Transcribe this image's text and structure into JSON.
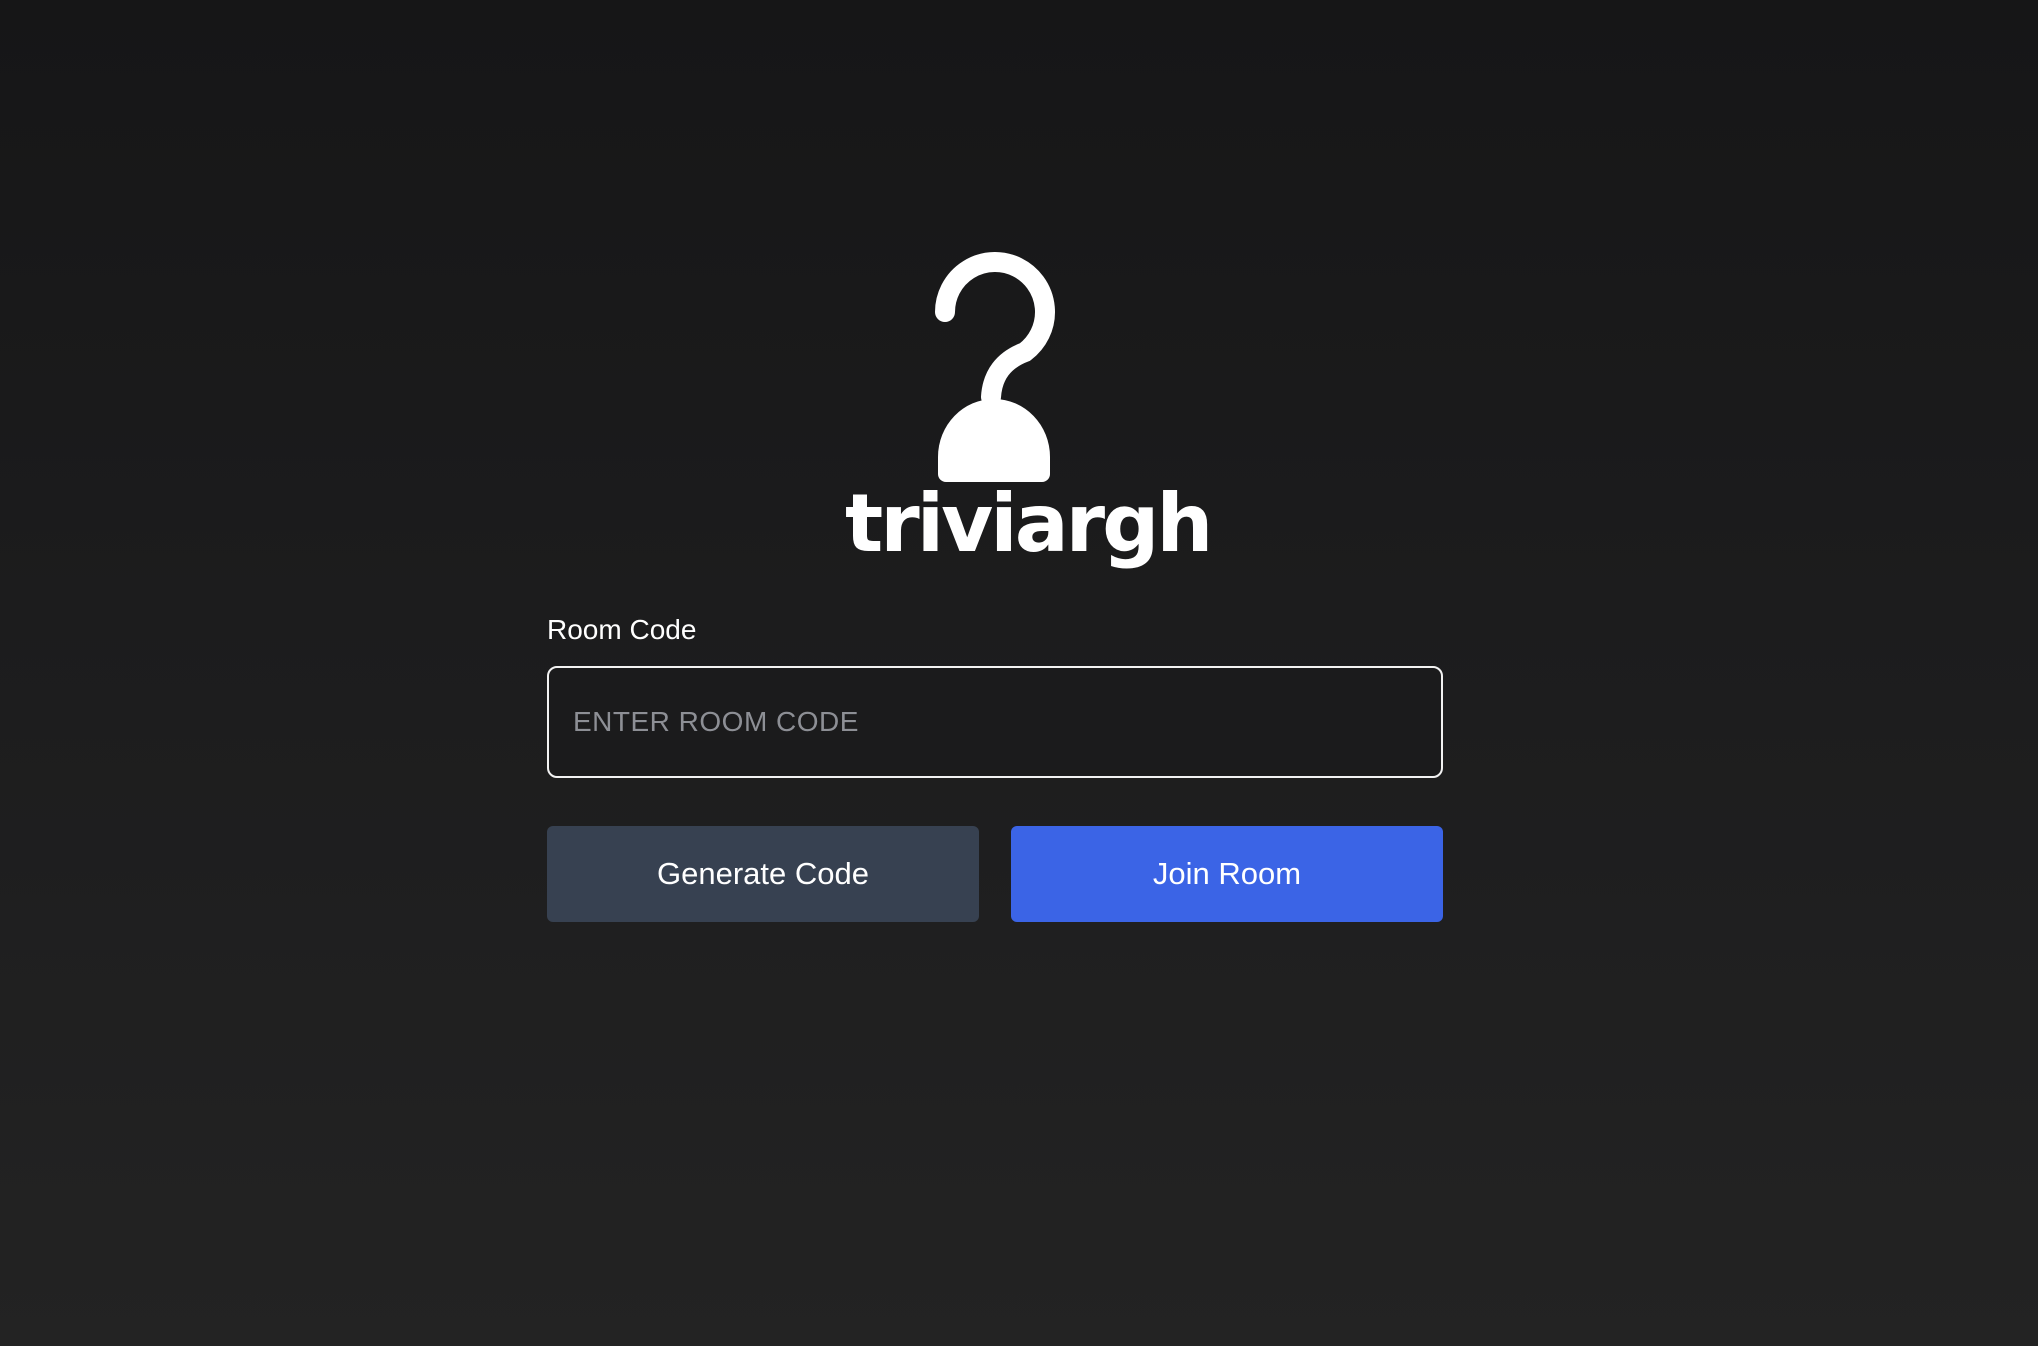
{
  "app": {
    "logo_icon": "hook-question-icon",
    "name": "triviargh"
  },
  "form": {
    "label": "Room Code",
    "input_value": "",
    "input_placeholder": "ENTER ROOM CODE",
    "generate_label": "Generate Code",
    "join_label": "Join Room"
  },
  "colors": {
    "background": "#1c1c1d",
    "input_border": "#f2f2f2",
    "generate_button": "#374151",
    "join_button": "#3b64e6",
    "text": "#ffffff",
    "placeholder": "#8d8f95"
  }
}
